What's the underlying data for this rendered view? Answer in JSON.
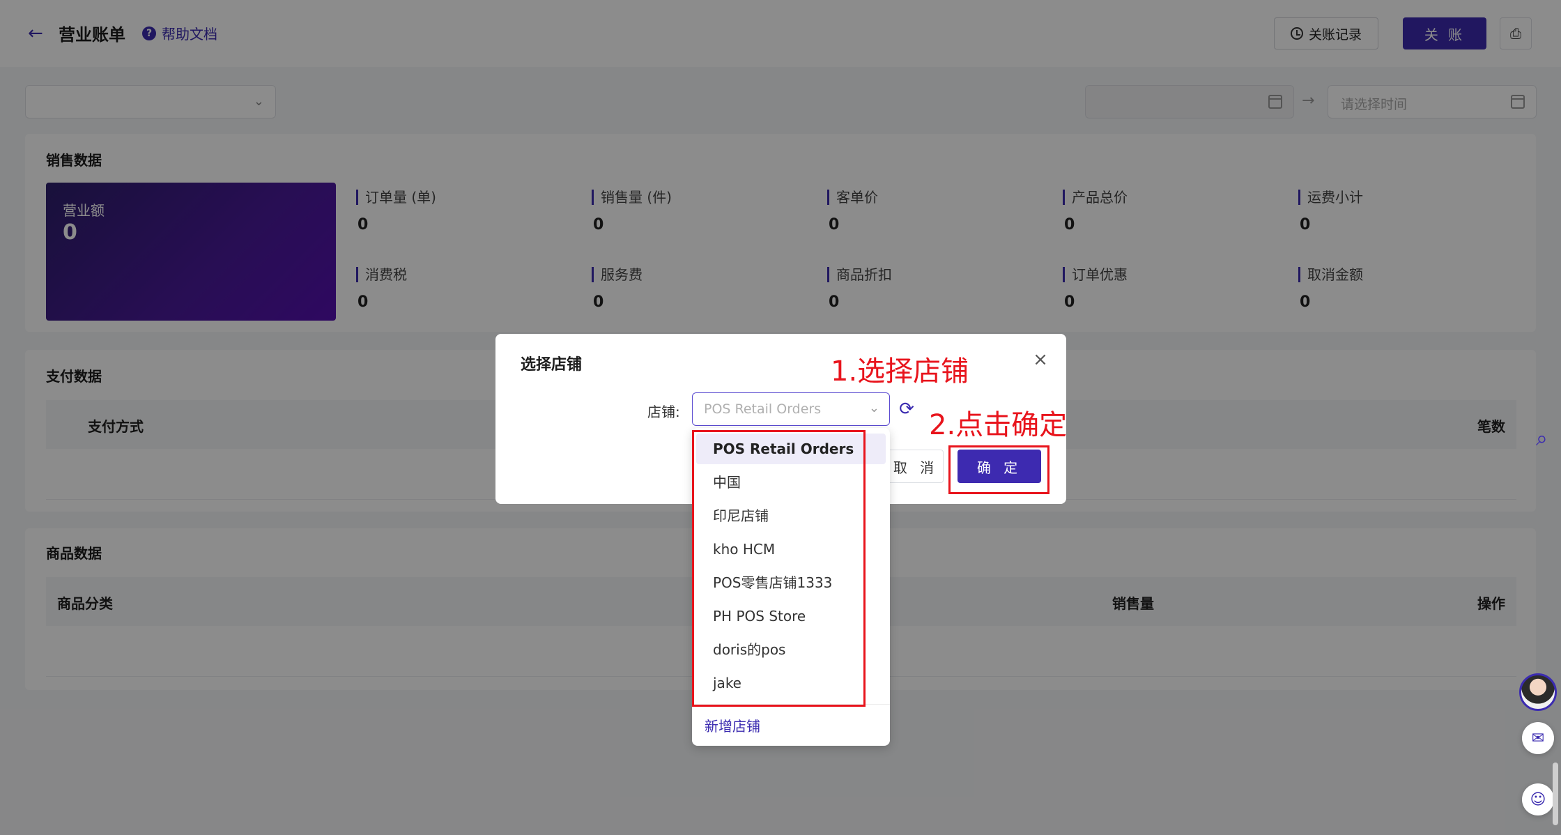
{
  "header": {
    "title": "营业账单",
    "help_label": "帮助文档",
    "records_label": "关账记录",
    "close_account_label": "关 账"
  },
  "filters": {
    "date_end_placeholder": "请选择时间"
  },
  "sales": {
    "title": "销售数据",
    "revenue": {
      "label": "营业额",
      "value": "0"
    },
    "metrics": [
      {
        "label": "订单量 (单)",
        "value": "0"
      },
      {
        "label": "销售量 (件)",
        "value": "0"
      },
      {
        "label": "客单价",
        "value": "0"
      },
      {
        "label": "产品总价",
        "value": "0"
      },
      {
        "label": "运费小计",
        "value": "0"
      },
      {
        "label": "消费税",
        "value": "0"
      },
      {
        "label": "服务费",
        "value": "0"
      },
      {
        "label": "商品折扣",
        "value": "0"
      },
      {
        "label": "订单优惠",
        "value": "0"
      },
      {
        "label": "取消金额",
        "value": "0"
      }
    ]
  },
  "payment": {
    "title": "支付数据",
    "columns": [
      "支付方式",
      "笔数"
    ]
  },
  "goods": {
    "title": "商品数据",
    "columns": [
      "商品分类",
      "销售量",
      "操作"
    ]
  },
  "modal": {
    "title": "选择店铺",
    "field_label": "店铺:",
    "select_placeholder": "POS Retail Orders",
    "cancel_label": "取 消",
    "ok_label": "确 定"
  },
  "dropdown": {
    "options": [
      "POS Retail Orders",
      "中国",
      "印尼店铺",
      "kho HCM",
      "POS零售店铺1333",
      "PH POS Store",
      "doris的pos",
      "jake"
    ],
    "selected_index": 0,
    "add_label": "新增店铺"
  },
  "annotations": {
    "step1": "1.选择店铺",
    "step2": "2.点击确定"
  },
  "colors": {
    "accent": "#3d2ab0",
    "annotation": "#e8141c"
  }
}
